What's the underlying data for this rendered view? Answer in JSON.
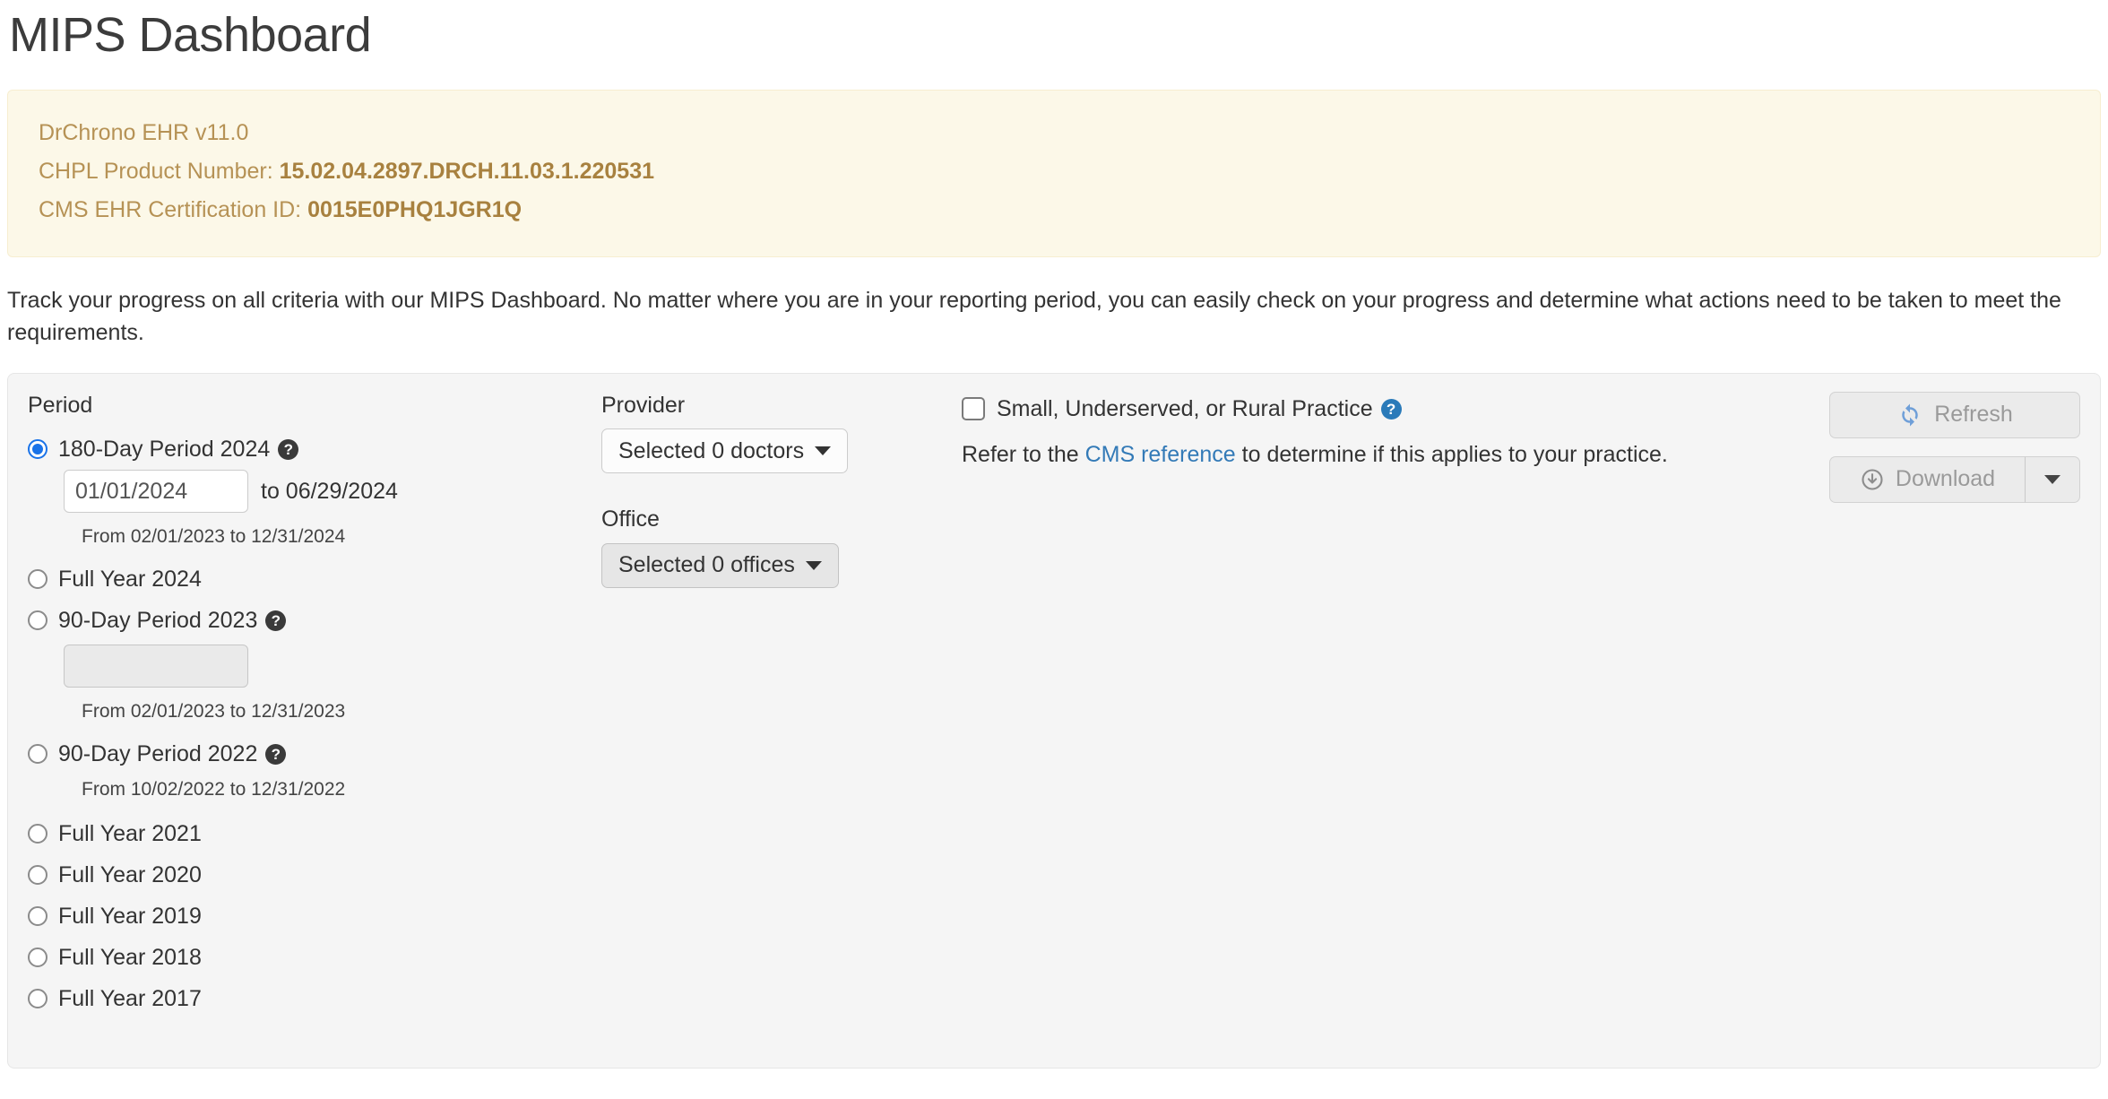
{
  "page": {
    "title": "MIPS Dashboard",
    "intro": "Track your progress on all criteria with our MIPS Dashboard. No matter where you are in your reporting period, you can easily check on your progress and determine what actions need to be taken to meet the requirements."
  },
  "alert": {
    "version_line": "DrChrono EHR v11.0",
    "chpl_label": "CHPL Product Number: ",
    "chpl_value": "15.02.04.2897.DRCH.11.03.1.220531",
    "cms_label": "CMS EHR Certification ID: ",
    "cms_value": "0015E0PHQ1JGR1Q",
    "text_color": "#b69255",
    "background": "#fcf8e8"
  },
  "filters": {
    "period": {
      "label": "Period",
      "options": [
        {
          "label": "180-Day Period 2024",
          "help": true,
          "selected": true
        },
        {
          "label": "Full Year 2024",
          "help": false,
          "selected": false
        },
        {
          "label": "90-Day Period 2023",
          "help": true,
          "selected": false
        },
        {
          "label": "90-Day Period 2022",
          "help": true,
          "selected": false
        },
        {
          "label": "Full Year 2021",
          "help": false,
          "selected": false
        },
        {
          "label": "Full Year 2020",
          "help": false,
          "selected": false
        },
        {
          "label": "Full Year 2019",
          "help": false,
          "selected": false
        },
        {
          "label": "Full Year 2018",
          "help": false,
          "selected": false
        },
        {
          "label": "Full Year 2017",
          "help": false,
          "selected": false
        }
      ],
      "date_2024_value": "01/01/2024",
      "date_2024_to": "to 06/29/2024",
      "range_note_2024": "From 02/01/2023 to 12/31/2024",
      "date_2023_value": "",
      "range_note_2023": "From 02/01/2023 to 12/31/2023",
      "range_note_2022": "From 10/02/2022 to 12/31/2022"
    },
    "provider": {
      "label": "Provider",
      "button": "Selected 0 doctors"
    },
    "office": {
      "label": "Office",
      "button": "Selected 0 offices"
    },
    "small_practice": {
      "checkbox_label": "Small, Underserved, or Rural Practice",
      "checked": false,
      "refer_prefix": "Refer to the ",
      "link_text": "CMS reference",
      "refer_suffix": " to determine if this applies to your practice.",
      "link_color": "#337ab7"
    },
    "actions": {
      "refresh_label": "Refresh",
      "download_label": "Download",
      "refresh_icon_color": "#6f9fd8"
    }
  }
}
